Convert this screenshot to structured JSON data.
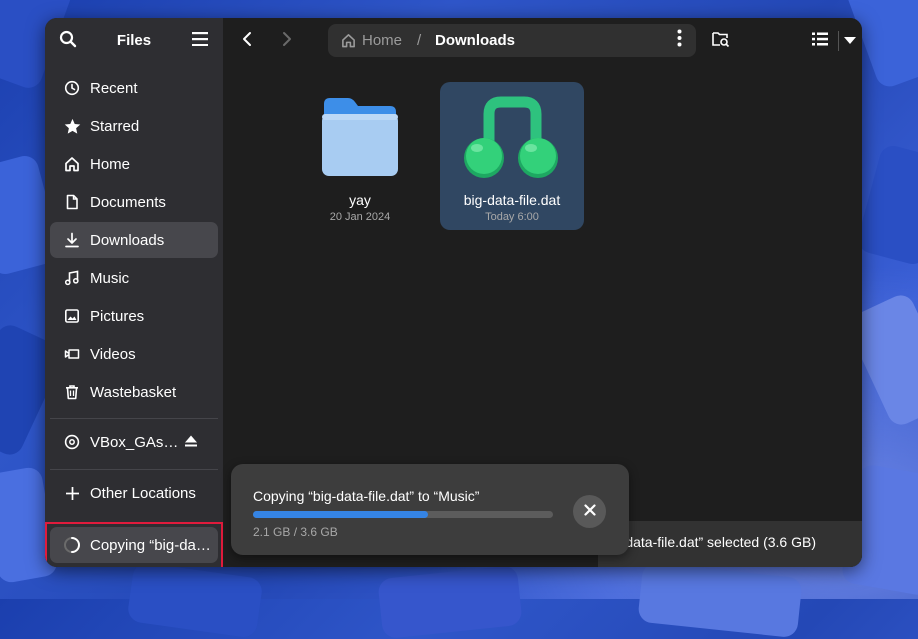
{
  "sidebar": {
    "title": "Files",
    "items": [
      {
        "label": "Recent",
        "icon": "clock-icon"
      },
      {
        "label": "Starred",
        "icon": "star-icon"
      },
      {
        "label": "Home",
        "icon": "home-icon"
      },
      {
        "label": "Documents",
        "icon": "document-icon"
      },
      {
        "label": "Downloads",
        "icon": "download-icon",
        "active": true
      },
      {
        "label": "Music",
        "icon": "music-icon"
      },
      {
        "label": "Pictures",
        "icon": "picture-icon"
      },
      {
        "label": "Videos",
        "icon": "video-icon"
      },
      {
        "label": "Wastebasket",
        "icon": "trash-icon"
      }
    ],
    "drive": {
      "label": "VBox_GAs…",
      "icon": "disc-icon",
      "action_icon": "eject-icon"
    },
    "other_locations": {
      "label": "Other Locations",
      "icon": "plus-icon"
    },
    "operation": {
      "label": "Copying “big-da…",
      "icon": "spinner-icon"
    }
  },
  "pathbar": {
    "home": "Home",
    "separator": "/",
    "current": "Downloads"
  },
  "files": [
    {
      "name": "yay",
      "date": "20 Jan 2024",
      "icon": "folder-icon",
      "selected": false
    },
    {
      "name": "big-data-file.dat",
      "date": "Today 6:00",
      "icon": "music-file-icon",
      "selected": true
    }
  ],
  "toast": {
    "title": "Copying “big-data-file.dat” to “Music”",
    "progress_text": "2.1 GB / 3.6 GB",
    "progress_fraction": 0.5833
  },
  "statusbar": {
    "text": "big-data-file.dat” selected  (3.6 GB)"
  },
  "colors": {
    "accent": "#3584e4",
    "selection": "#304762",
    "highlight_border": "#e01b3c",
    "sidebar_bg": "#2e2e32",
    "window_bg": "#1e1e1e"
  }
}
